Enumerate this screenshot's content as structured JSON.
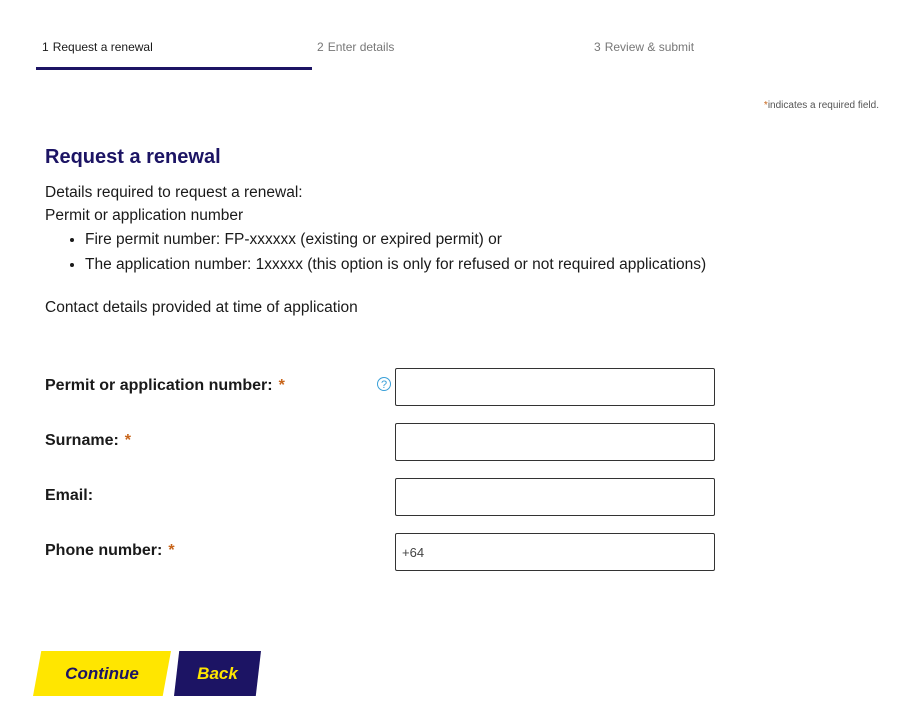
{
  "steps": [
    {
      "num": "1",
      "label": "Request a renewal"
    },
    {
      "num": "2",
      "label": "Enter details"
    },
    {
      "num": "3",
      "label": "Review & submit"
    }
  ],
  "required_note": {
    "star": "*",
    "text": "indicates a required field."
  },
  "heading": "Request a renewal",
  "intro": {
    "line1": "Details required to request a renewal:",
    "line2": "Permit or application number",
    "bullets": [
      "Fire permit number: FP-xxxxxx (existing or expired permit) or",
      "The application number: 1xxxxx (this option is only for refused or not required applications)"
    ],
    "contact": "Contact details provided at time of application"
  },
  "form": {
    "permit_label": "Permit or application number:",
    "surname_label": "Surname:",
    "email_label": "Email:",
    "phone_label": "Phone number:",
    "required_star": "*",
    "help_icon": "question-circle-icon",
    "help_glyph": "?",
    "phone_value": "+64"
  },
  "buttons": {
    "continue": "Continue",
    "back": "Back"
  },
  "colors": {
    "primary": "#1c1464",
    "accent": "#ffe600",
    "required": "#c8651b",
    "help": "#3aa0d8"
  }
}
